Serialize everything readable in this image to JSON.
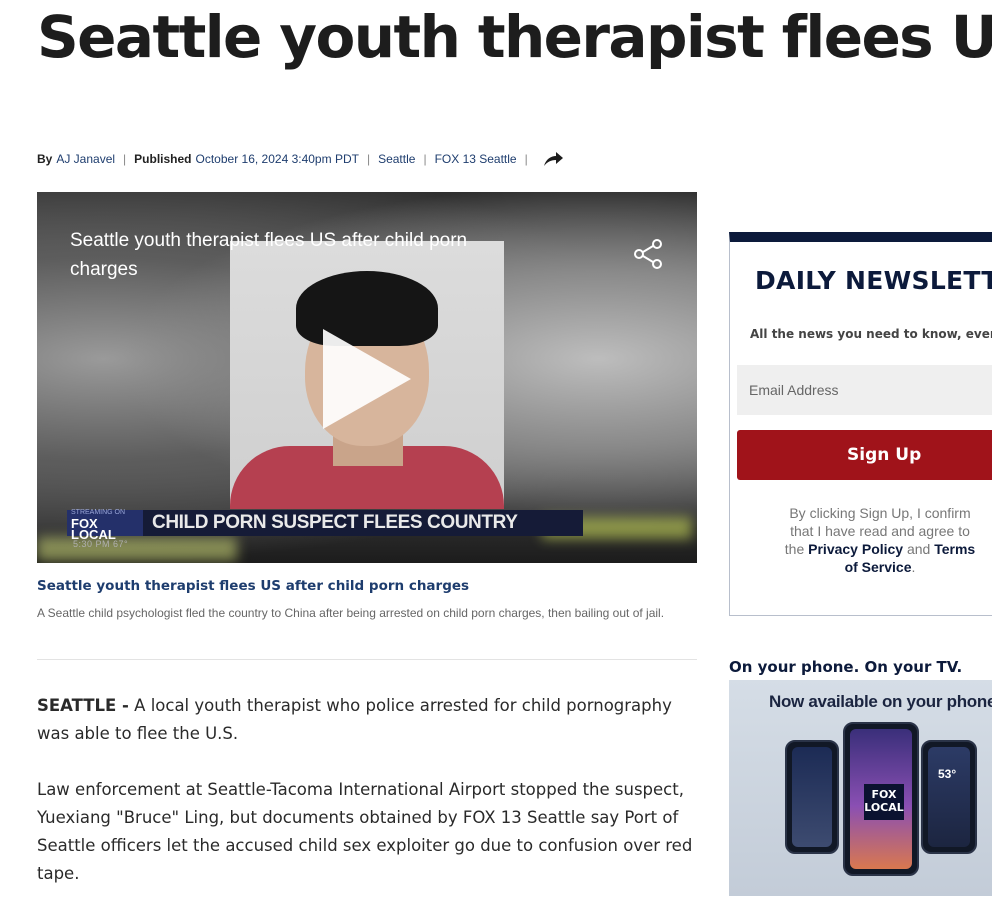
{
  "article": {
    "headline": "Seattle youth therapist flees US after child porn charges",
    "byline_prefix": "By",
    "author": "AJ Janavel",
    "published_label": "Published",
    "published_date": "October 16, 2024 3:40pm PDT",
    "tags": [
      "Seattle",
      "FOX 13 Seattle"
    ],
    "share_icon": "share-arrow-icon"
  },
  "video": {
    "title": "Seattle youth therapist flees US after child porn charges",
    "lower_third_logo_top": "STREAMING ON",
    "lower_third_logo": "FOX LOCAL",
    "lower_third_text": "CHILD PORN SUSPECT FLEES COUNTRY",
    "time_text": "5:30 PM  67°",
    "play_icon": "play-icon",
    "share_icon": "share-nodes-icon",
    "caption_title": "Seattle youth therapist flees US after child porn charges",
    "caption_desc": "A Seattle child psychologist fled the country to China after being arrested on child porn charges, then bailing out of jail."
  },
  "body": {
    "dateline": "SEATTLE -",
    "p1": " A local youth therapist who police arrested for child pornography was able to flee the U.S.",
    "p2": "Law enforcement at Seattle-Tacoma International Airport stopped the suspect, Yuexiang \"Bruce\" Ling, but documents obtained by FOX 13 Seattle say Port of Seattle officers let the accused child sex exploiter go due to confusion over red tape."
  },
  "newsletter": {
    "title": "DAILY NEWSLETTER",
    "subtitle": "All the news you need to know, every day",
    "email_placeholder": "Email Address",
    "signup_label": "Sign Up",
    "legal_prefix": "By clicking Sign Up, I confirm that I have read and agree to the",
    "privacy_label": "Privacy Policy",
    "legal_and": "and",
    "terms_label": "Terms of Service",
    "legal_suffix": "."
  },
  "promo": {
    "heading": "On your phone. On your TV.",
    "tagline": "Now available on your phone",
    "logo_line1": "FOX",
    "logo_line2": "LOCAL",
    "temp": "53°"
  },
  "colors": {
    "navy": "#0c1a3b",
    "link": "#1e3d6e",
    "signup_red": "#a0131a"
  }
}
